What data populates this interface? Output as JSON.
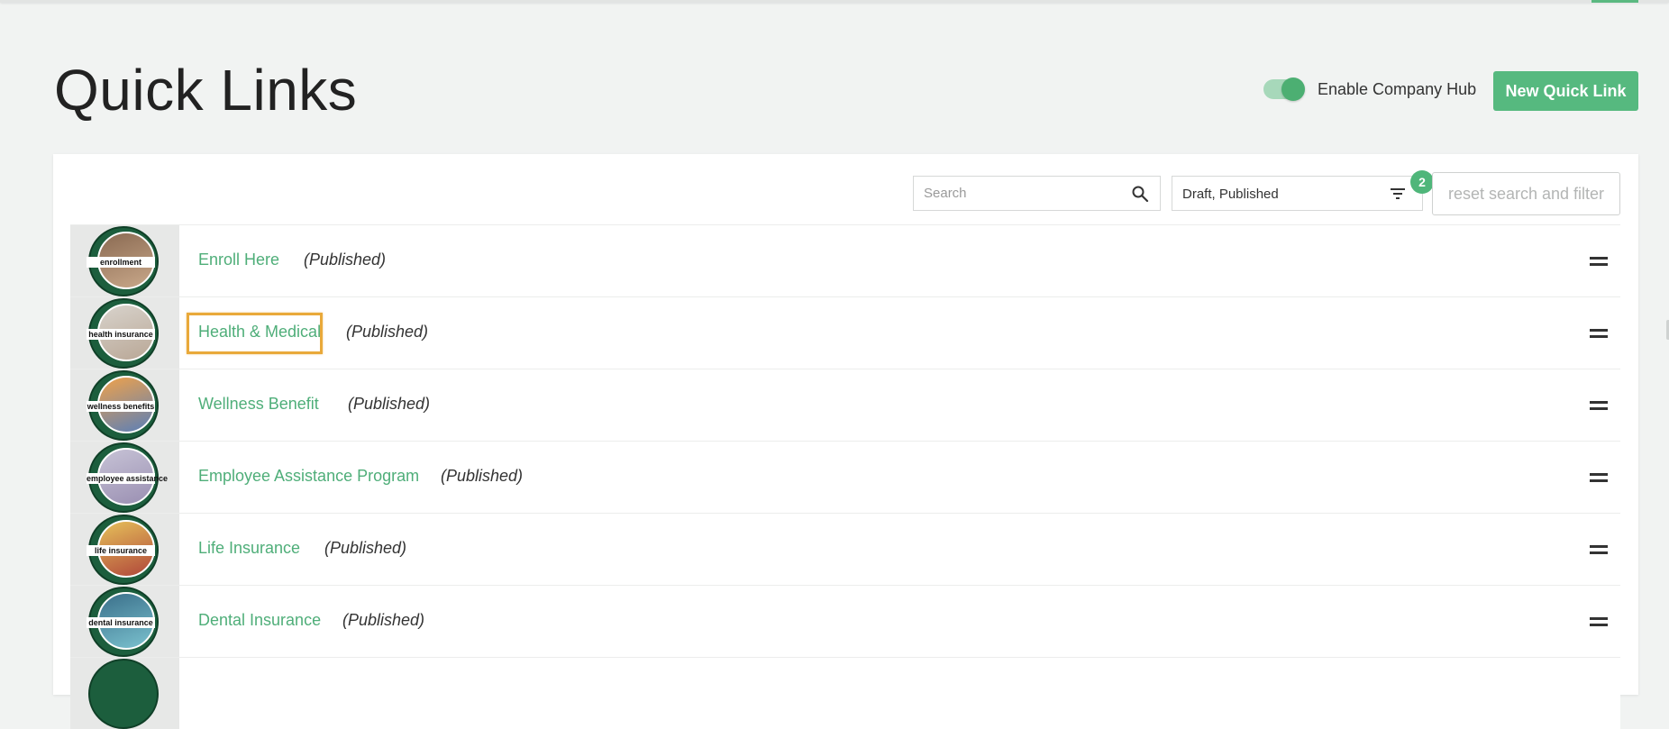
{
  "header": {
    "title": "Quick Links",
    "hub_toggle_label": "Enable Company Hub",
    "hub_toggle_on": true,
    "new_button_label": "New Quick Link"
  },
  "toolbar": {
    "search_placeholder": "Search",
    "filter_value": "Draft, Published",
    "filter_count": "2",
    "reset_label": "reset search and filter"
  },
  "colors": {
    "accent": "#56b97f",
    "link": "#4fae79",
    "highlight": "#e9a93a",
    "thumb_ring": "#1c5e3d"
  },
  "links": [
    {
      "title": "Enroll Here",
      "status": "(Published)",
      "thumb_label": "enrollment",
      "thumb_colors": [
        "#8a6a52",
        "#c9a88a"
      ]
    },
    {
      "title": "Health & Medical",
      "status": "(Published)",
      "thumb_label": "health insurance",
      "thumb_colors": [
        "#d8d3cc",
        "#b9a796"
      ]
    },
    {
      "title": "Wellness Benefit",
      "status": "(Published)",
      "thumb_label": "wellness benefits",
      "thumb_colors": [
        "#f0a24a",
        "#5a7fb8"
      ]
    },
    {
      "title": "Employee Assistance Program",
      "status": "(Published)",
      "thumb_label": "employee assistance",
      "thumb_colors": [
        "#c7c3d6",
        "#9a8fb2"
      ]
    },
    {
      "title": "Life Insurance",
      "status": "(Published)",
      "thumb_label": "life insurance",
      "thumb_colors": [
        "#e6c15a",
        "#b0463a"
      ]
    },
    {
      "title": "Dental Insurance",
      "status": "(Published)",
      "thumb_label": "dental insurance",
      "thumb_colors": [
        "#3a6f8a",
        "#7bc2cf"
      ]
    }
  ]
}
